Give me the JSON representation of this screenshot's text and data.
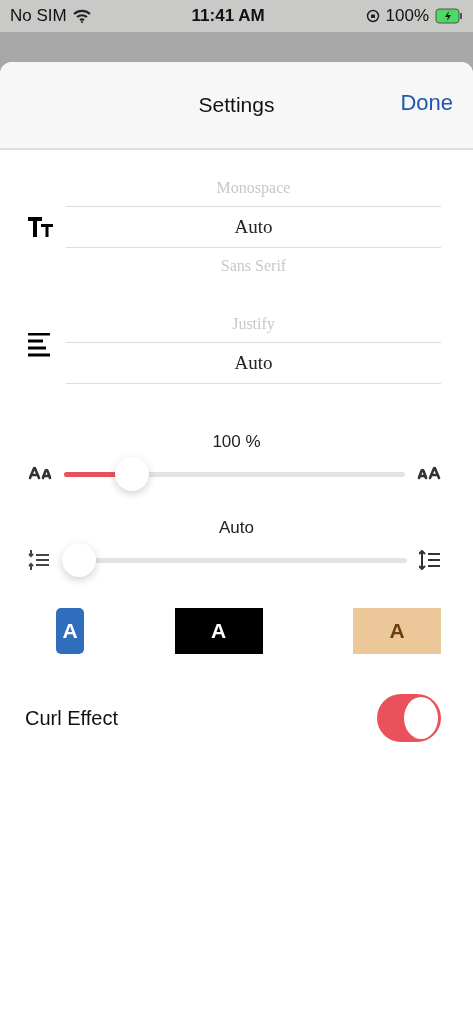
{
  "status_bar": {
    "carrier": "No SIM",
    "time": "11:41 AM",
    "battery": "100%"
  },
  "sheet": {
    "title": "Settings",
    "done": "Done"
  },
  "font_picker": {
    "items": [
      {
        "label": "Monospace",
        "selected": false
      },
      {
        "label": "Auto",
        "selected": true
      },
      {
        "label": "Sans Serif",
        "selected": false
      }
    ]
  },
  "align_picker": {
    "items": [
      {
        "label": "Justify",
        "selected": false
      },
      {
        "label": "Auto",
        "selected": true
      }
    ]
  },
  "font_size": {
    "reading": "100 %",
    "level": 0.2
  },
  "line_spacing": {
    "reading": "Auto",
    "level": 0.0
  },
  "themes": [
    {
      "label": "A",
      "selected": true,
      "color": "#2f6dbd"
    },
    {
      "label": "A",
      "selected": false,
      "color": "#000000"
    },
    {
      "label": "A",
      "selected": false,
      "color": "#ecc799"
    }
  ],
  "curl_effect": {
    "label": "Curl Effect",
    "on": true
  }
}
